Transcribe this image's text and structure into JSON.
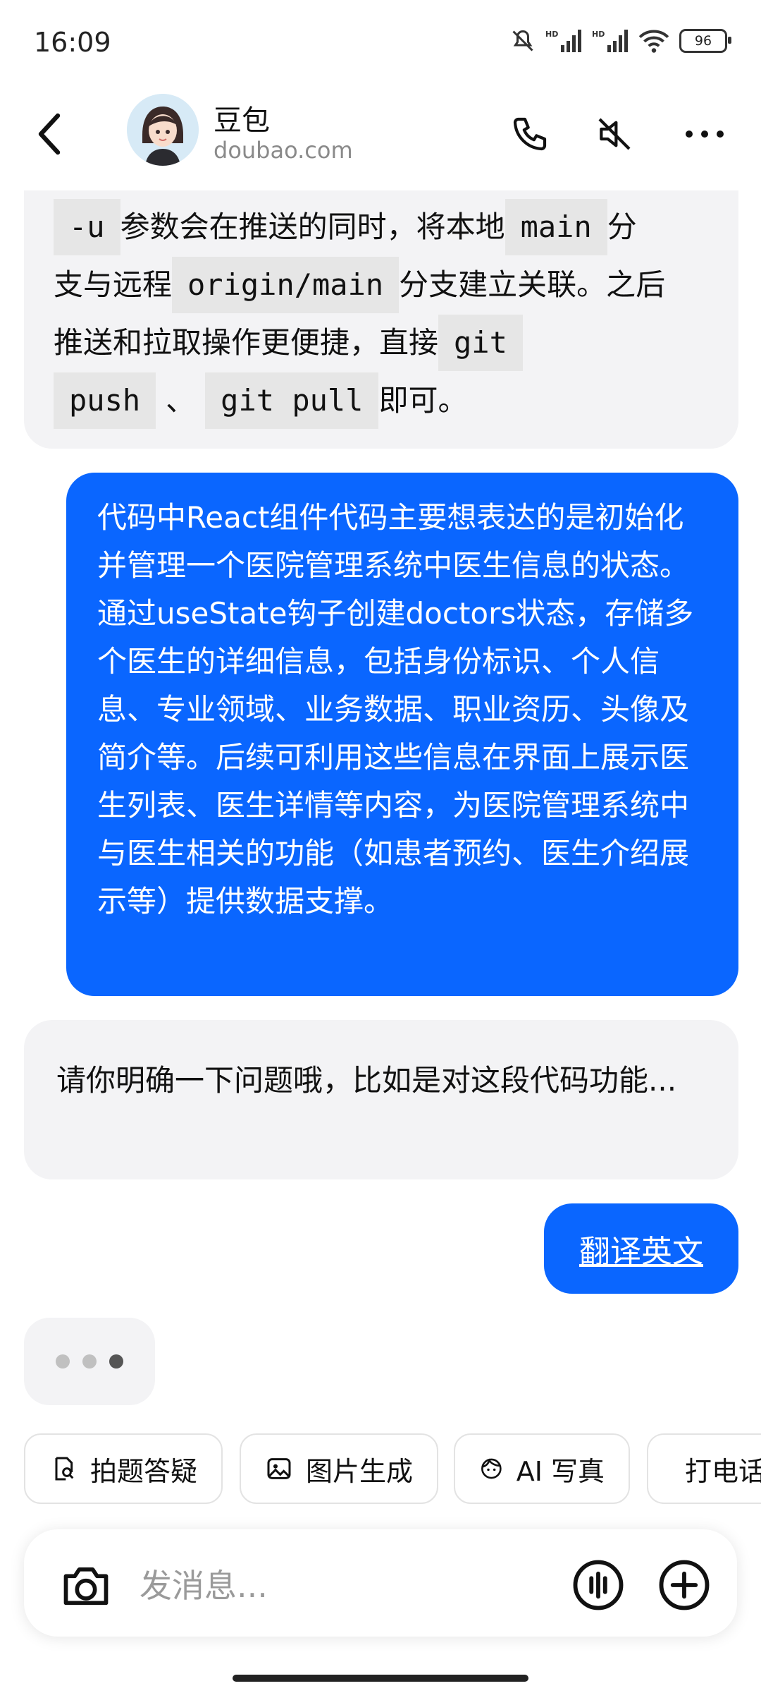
{
  "status_bar": {
    "time": "16:09",
    "battery": "96",
    "network1": "HD",
    "network2": "HD"
  },
  "header": {
    "title": "豆包",
    "subtitle": "doubao.com"
  },
  "messages": {
    "bot1": {
      "line1_code": "-u",
      "line1_text": "参数会在推送的同时，将本地",
      "line1_code2": "main",
      "line1_tail": "分",
      "line2_text": "支与远程",
      "line2_code": "origin/main",
      "line2_tail": "分支建立关联。之后",
      "line3_text": "推送和拉取操作更便捷，直接",
      "line3_code": "git",
      "line4_code": "push",
      "line4_sep": "、",
      "line4_code2": "git pull",
      "line4_tail": "即可。"
    },
    "user1": "代码中React组件代码主要想表达的是初始化并管理一个医院管理系统中医生信息的状态。通过useState钩子创建doctors状态，存储多个医生的详细信息，包括身份标识、个人信息、专业领域、业务数据、职业资历、头像及简介等。后续可利用这些信息在界面上展示医生列表、医生详情等内容，为医院管理系统中与医生相关的功能（如患者预约、医生介绍展示等）提供数据支撑。",
    "bot2": "请你明确一下问题哦，比如是对这段代码功能...",
    "user2": "翻译英文"
  },
  "quick_actions": [
    {
      "label": "拍题答疑",
      "icon": "photo-search-icon"
    },
    {
      "label": "图片生成",
      "icon": "image-icon"
    },
    {
      "label": "AI 写真",
      "icon": "face-icon"
    },
    {
      "label": "打电话",
      "icon": "phone-icon"
    }
  ],
  "input": {
    "placeholder": "发消息..."
  },
  "colors": {
    "user_bubble": "#0a66ff",
    "bot_bubble": "#f3f3f5"
  }
}
